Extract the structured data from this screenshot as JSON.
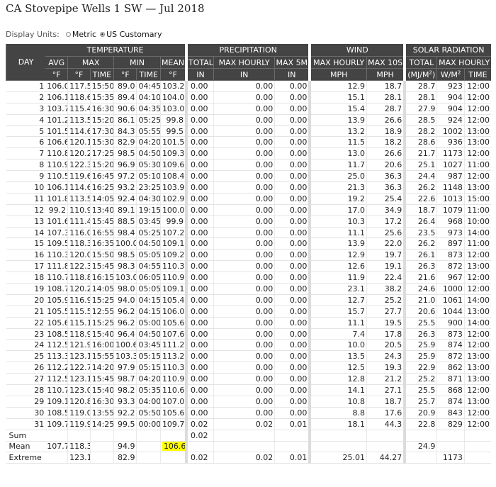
{
  "title": "CA Stovepipe Wells 1 SW — Jul 2018",
  "units": {
    "label": "Display Units:",
    "metric": "Metric",
    "us": "US Customary",
    "selected": "US Customary"
  },
  "header": {
    "day": "DAY",
    "groups": {
      "temperature": "TEMPERATURE",
      "precipitation": "PRECIPITATION",
      "wind": "WIND",
      "solar": "SOLAR RADIATION"
    },
    "cols": {
      "avg": "AVG",
      "max": "MAX",
      "min": "MIN",
      "mean": "MEAN",
      "total": "TOTAL",
      "max_hourly": "MAX HOURLY",
      "max_5m": "MAX 5M",
      "wind_max_hourly": "MAX HOURLY",
      "max_10s": "MAX 10S",
      "solar_total": "TOTAL",
      "solar_max_hourly": "MAX HOURLY"
    },
    "units": {
      "degf": "°F",
      "time": "TIME",
      "in": "IN",
      "mph": "MPH",
      "mj": "(MJ/M²)",
      "wm": "W/M²"
    }
  },
  "rows": [
    [
      "1",
      "106.0",
      "117.5",
      "15:50",
      "89.0",
      "04:45",
      "103.2",
      "0.00",
      "0.00",
      "0.00",
      "12.9",
      "18.7",
      "28.7",
      "923",
      "12:00"
    ],
    [
      "2",
      "106.1",
      "118.6",
      "15:35",
      "89.4",
      "04:10",
      "104.0",
      "0.00",
      "0.00",
      "0.00",
      "15.1",
      "28.1",
      "28.1",
      "904",
      "12:00"
    ],
    [
      "3",
      "103.7",
      "115.4",
      "16:30",
      "90.6",
      "04:35",
      "103.0",
      "0.00",
      "0.00",
      "0.00",
      "15.4",
      "28.7",
      "27.9",
      "904",
      "12:00"
    ],
    [
      "4",
      "101.2",
      "113.5",
      "15:20",
      "86.1",
      "05:25",
      "99.8",
      "0.00",
      "0.00",
      "0.00",
      "13.9",
      "26.6",
      "28.5",
      "924",
      "12:00"
    ],
    [
      "5",
      "101.5",
      "114.6",
      "17:30",
      "84.3",
      "05:55",
      "99.5",
      "0.00",
      "0.00",
      "0.00",
      "13.2",
      "18.9",
      "28.2",
      "1002",
      "13:00"
    ],
    [
      "6",
      "106.6",
      "120.1",
      "15:30",
      "82.9",
      "04:20",
      "101.5",
      "0.00",
      "0.00",
      "0.00",
      "11.5",
      "18.2",
      "28.6",
      "936",
      "13:00"
    ],
    [
      "7",
      "110.8",
      "120.2",
      "17:25",
      "98.5",
      "04:50",
      "109.3",
      "0.00",
      "0.00",
      "0.00",
      "13.0",
      "26.6",
      "21.7",
      "1173",
      "12:00"
    ],
    [
      "8",
      "110.9",
      "122.3",
      "15:20",
      "96.9",
      "05:30",
      "109.6",
      "0.00",
      "0.00",
      "0.00",
      "11.7",
      "20.6",
      "25.1",
      "1027",
      "11:00"
    ],
    [
      "9",
      "110.5",
      "119.6",
      "16:45",
      "97.2",
      "05:10",
      "108.4",
      "0.00",
      "0.00",
      "0.00",
      "25.0",
      "36.3",
      "24.4",
      "987",
      "12:00"
    ],
    [
      "10",
      "106.1",
      "114.6",
      "16:25",
      "93.2",
      "23:25",
      "103.9",
      "0.00",
      "0.00",
      "0.00",
      "21.3",
      "36.3",
      "26.2",
      "1148",
      "13:00"
    ],
    [
      "11",
      "101.8",
      "113.5",
      "14:05",
      "92.4",
      "04:30",
      "102.9",
      "0.00",
      "0.00",
      "0.00",
      "19.2",
      "25.4",
      "22.6",
      "1013",
      "15:00"
    ],
    [
      "12",
      "99.2",
      "110.9",
      "13:40",
      "89.1",
      "19:15",
      "100.0",
      "0.00",
      "0.00",
      "0.00",
      "17.0",
      "34.9",
      "18.7",
      "1079",
      "11:00"
    ],
    [
      "13",
      "101.6",
      "111.4",
      "15:45",
      "88.5",
      "03:45",
      "99.9",
      "0.00",
      "0.00",
      "0.00",
      "10.3",
      "17.2",
      "26.4",
      "968",
      "10:00"
    ],
    [
      "14",
      "107.3",
      "116.0",
      "16:55",
      "98.4",
      "05:25",
      "107.2",
      "0.00",
      "0.00",
      "0.00",
      "11.1",
      "25.6",
      "23.5",
      "973",
      "14:00"
    ],
    [
      "15",
      "109.5",
      "118.3",
      "16:35",
      "100.0",
      "04:50",
      "109.1",
      "0.00",
      "0.00",
      "0.00",
      "13.9",
      "22.0",
      "26.2",
      "897",
      "11:00"
    ],
    [
      "16",
      "110.3",
      "120.0",
      "15:50",
      "98.5",
      "05:05",
      "109.2",
      "0.00",
      "0.00",
      "0.00",
      "12.9",
      "19.7",
      "26.1",
      "873",
      "12:00"
    ],
    [
      "17",
      "111.8",
      "122.3",
      "15:45",
      "98.3",
      "04:55",
      "110.3",
      "0.00",
      "0.00",
      "0.00",
      "12.6",
      "19.1",
      "26.3",
      "872",
      "13:00"
    ],
    [
      "18",
      "110.7",
      "118.8",
      "16:15",
      "103.0",
      "06:05",
      "110.9",
      "0.00",
      "0.00",
      "0.00",
      "11.9",
      "22.4",
      "21.6",
      "967",
      "12:00"
    ],
    [
      "19",
      "108.7",
      "120.2",
      "14:05",
      "98.0",
      "05:05",
      "109.1",
      "0.00",
      "0.00",
      "0.00",
      "23.1",
      "38.2",
      "24.6",
      "1000",
      "12:00"
    ],
    [
      "20",
      "105.9",
      "116.9",
      "15:25",
      "94.0",
      "04:15",
      "105.4",
      "0.00",
      "0.00",
      "0.00",
      "12.7",
      "25.2",
      "21.0",
      "1061",
      "14:00"
    ],
    [
      "21",
      "105.5",
      "115.5",
      "12:55",
      "96.2",
      "04:15",
      "106.0",
      "0.00",
      "0.00",
      "0.00",
      "15.7",
      "27.7",
      "20.6",
      "1044",
      "13:00"
    ],
    [
      "22",
      "105.6",
      "115.1",
      "15:25",
      "96.2",
      "05:00",
      "105.6",
      "0.00",
      "0.00",
      "0.00",
      "11.1",
      "19.5",
      "25.5",
      "900",
      "14:00"
    ],
    [
      "23",
      "108.5",
      "118.9",
      "15:40",
      "96.4",
      "04:50",
      "107.6",
      "0.00",
      "0.00",
      "0.00",
      "7.4",
      "17.8",
      "26.3",
      "873",
      "12:00"
    ],
    [
      "24",
      "112.5",
      "121.9",
      "16:00",
      "100.6",
      "03:45",
      "111.2",
      "0.00",
      "0.00",
      "0.00",
      "10.0",
      "20.5",
      "25.9",
      "874",
      "12:00"
    ],
    [
      "25",
      "113.3",
      "123.1",
      "15:55",
      "103.3",
      "05:15",
      "113.2",
      "0.00",
      "0.00",
      "0.00",
      "13.5",
      "24.3",
      "25.9",
      "872",
      "13:00"
    ],
    [
      "26",
      "112.2",
      "122.7",
      "14:20",
      "97.9",
      "05:15",
      "110.3",
      "0.00",
      "0.00",
      "0.00",
      "12.5",
      "19.3",
      "22.9",
      "862",
      "13:00"
    ],
    [
      "27",
      "112.5",
      "123.1",
      "15:45",
      "98.7",
      "04:20",
      "110.9",
      "0.00",
      "0.00",
      "0.00",
      "12.8",
      "21.2",
      "25.2",
      "871",
      "13:00"
    ],
    [
      "28",
      "110.7",
      "123.0",
      "15:40",
      "98.2",
      "05:35",
      "110.6",
      "0.00",
      "0.00",
      "0.00",
      "14.1",
      "27.1",
      "25.5",
      "868",
      "12:00"
    ],
    [
      "29",
      "109.1",
      "120.8",
      "16:30",
      "93.3",
      "04:00",
      "107.0",
      "0.00",
      "0.00",
      "0.00",
      "10.8",
      "18.7",
      "25.7",
      "874",
      "13:00"
    ],
    [
      "30",
      "108.5",
      "119.0",
      "13:55",
      "92.2",
      "05:50",
      "105.6",
      "0.00",
      "0.00",
      "0.00",
      "8.8",
      "17.6",
      "20.9",
      "843",
      "12:00"
    ],
    [
      "31",
      "109.7",
      "119.9",
      "14:25",
      "99.5",
      "00:00",
      "109.7",
      "0.02",
      "0.02",
      "0.01",
      "18.1",
      "44.3",
      "22.8",
      "829",
      "12:00"
    ]
  ],
  "summary": {
    "sum": {
      "label": "Sum",
      "precip_total": "0.02"
    },
    "mean": {
      "label": "Mean",
      "avg": "107.7",
      "max": "118.3",
      "min": "94.9",
      "mean": "106.6",
      "solar_total": "24.9"
    },
    "extreme": {
      "label": "Extreme",
      "max": "123.1",
      "min": "82.9",
      "precip_total": "0.02",
      "precip_max_hourly": "0.02",
      "precip_max_5m": "0.01",
      "wind_max_hourly": "25.01",
      "wind_max_10s": "44.27",
      "solar_max_hourly": "1173"
    }
  },
  "colors": {
    "header_bg": "#444444",
    "highlight": "#ffff00"
  }
}
